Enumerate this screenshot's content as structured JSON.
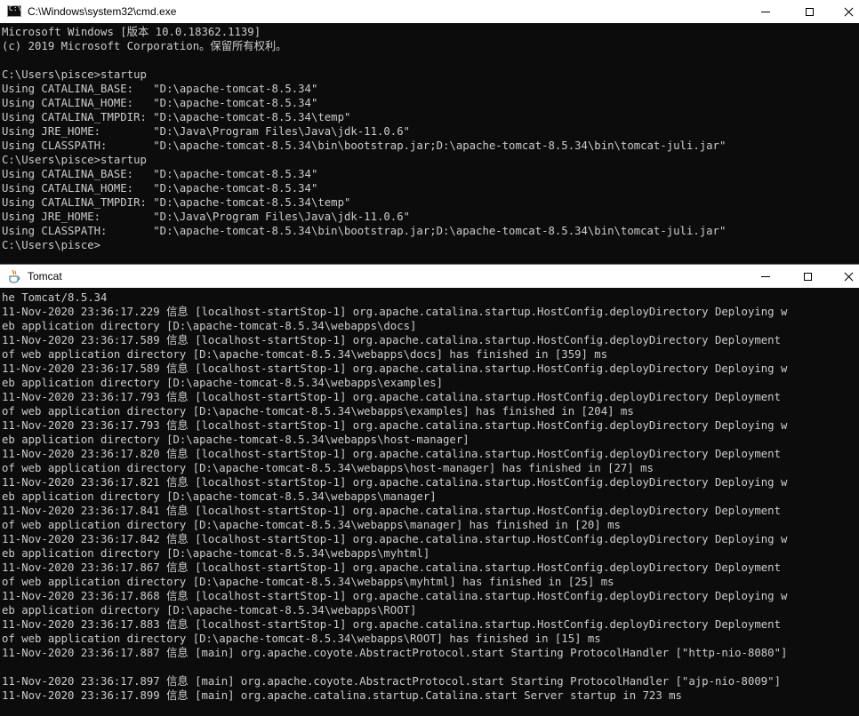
{
  "cmd_window": {
    "title": "C:\\Windows\\system32\\cmd.exe",
    "lines": [
      "Microsoft Windows [版本 10.0.18362.1139]",
      "(c) 2019 Microsoft Corporation。保留所有权利。",
      "",
      "C:\\Users\\pisce>startup",
      "Using CATALINA_BASE:   \"D:\\apache-tomcat-8.5.34\"",
      "Using CATALINA_HOME:   \"D:\\apache-tomcat-8.5.34\"",
      "Using CATALINA_TMPDIR: \"D:\\apache-tomcat-8.5.34\\temp\"",
      "Using JRE_HOME:        \"D:\\Java\\Program Files\\Java\\jdk-11.0.6\"",
      "Using CLASSPATH:       \"D:\\apache-tomcat-8.5.34\\bin\\bootstrap.jar;D:\\apache-tomcat-8.5.34\\bin\\tomcat-juli.jar\"",
      "C:\\Users\\pisce>startup",
      "Using CATALINA_BASE:   \"D:\\apache-tomcat-8.5.34\"",
      "Using CATALINA_HOME:   \"D:\\apache-tomcat-8.5.34\"",
      "Using CATALINA_TMPDIR: \"D:\\apache-tomcat-8.5.34\\temp\"",
      "Using JRE_HOME:        \"D:\\Java\\Program Files\\Java\\jdk-11.0.6\"",
      "Using CLASSPATH:       \"D:\\apache-tomcat-8.5.34\\bin\\bootstrap.jar;D:\\apache-tomcat-8.5.34\\bin\\tomcat-juli.jar\"",
      "C:\\Users\\pisce>"
    ]
  },
  "tomcat_window": {
    "title": "Tomcat",
    "lines": [
      "he Tomcat/8.5.34",
      "11-Nov-2020 23:36:17.229 信息 [localhost-startStop-1] org.apache.catalina.startup.HostConfig.deployDirectory Deploying w",
      "eb application directory [D:\\apache-tomcat-8.5.34\\webapps\\docs]",
      "11-Nov-2020 23:36:17.589 信息 [localhost-startStop-1] org.apache.catalina.startup.HostConfig.deployDirectory Deployment",
      "of web application directory [D:\\apache-tomcat-8.5.34\\webapps\\docs] has finished in [359] ms",
      "11-Nov-2020 23:36:17.589 信息 [localhost-startStop-1] org.apache.catalina.startup.HostConfig.deployDirectory Deploying w",
      "eb application directory [D:\\apache-tomcat-8.5.34\\webapps\\examples]",
      "11-Nov-2020 23:36:17.793 信息 [localhost-startStop-1] org.apache.catalina.startup.HostConfig.deployDirectory Deployment",
      "of web application directory [D:\\apache-tomcat-8.5.34\\webapps\\examples] has finished in [204] ms",
      "11-Nov-2020 23:36:17.793 信息 [localhost-startStop-1] org.apache.catalina.startup.HostConfig.deployDirectory Deploying w",
      "eb application directory [D:\\apache-tomcat-8.5.34\\webapps\\host-manager]",
      "11-Nov-2020 23:36:17.820 信息 [localhost-startStop-1] org.apache.catalina.startup.HostConfig.deployDirectory Deployment",
      "of web application directory [D:\\apache-tomcat-8.5.34\\webapps\\host-manager] has finished in [27] ms",
      "11-Nov-2020 23:36:17.821 信息 [localhost-startStop-1] org.apache.catalina.startup.HostConfig.deployDirectory Deploying w",
      "eb application directory [D:\\apache-tomcat-8.5.34\\webapps\\manager]",
      "11-Nov-2020 23:36:17.841 信息 [localhost-startStop-1] org.apache.catalina.startup.HostConfig.deployDirectory Deployment",
      "of web application directory [D:\\apache-tomcat-8.5.34\\webapps\\manager] has finished in [20] ms",
      "11-Nov-2020 23:36:17.842 信息 [localhost-startStop-1] org.apache.catalina.startup.HostConfig.deployDirectory Deploying w",
      "eb application directory [D:\\apache-tomcat-8.5.34\\webapps\\myhtml]",
      "11-Nov-2020 23:36:17.867 信息 [localhost-startStop-1] org.apache.catalina.startup.HostConfig.deployDirectory Deployment",
      "of web application directory [D:\\apache-tomcat-8.5.34\\webapps\\myhtml] has finished in [25] ms",
      "11-Nov-2020 23:36:17.868 信息 [localhost-startStop-1] org.apache.catalina.startup.HostConfig.deployDirectory Deploying w",
      "eb application directory [D:\\apache-tomcat-8.5.34\\webapps\\ROOT]",
      "11-Nov-2020 23:36:17.883 信息 [localhost-startStop-1] org.apache.catalina.startup.HostConfig.deployDirectory Deployment",
      "of web application directory [D:\\apache-tomcat-8.5.34\\webapps\\ROOT] has finished in [15] ms",
      "11-Nov-2020 23:36:17.887 信息 [main] org.apache.coyote.AbstractProtocol.start Starting ProtocolHandler [\"http-nio-8080\"]",
      "",
      "11-Nov-2020 23:36:17.897 信息 [main] org.apache.coyote.AbstractProtocol.start Starting ProtocolHandler [\"ajp-nio-8009\"]",
      "11-Nov-2020 23:36:17.899 信息 [main] org.apache.catalina.startup.Catalina.start Server startup in 723 ms"
    ]
  },
  "icons": {
    "cmd": "cmd-console-icon",
    "tomcat": "java-coffee-cup-icon",
    "minimize": "minimize-icon",
    "maximize": "maximize-icon",
    "close": "close-icon"
  },
  "colors": {
    "console_bg": "#0c0c0c",
    "console_fg": "#cccccc",
    "titlebar_bg": "#ffffff"
  }
}
